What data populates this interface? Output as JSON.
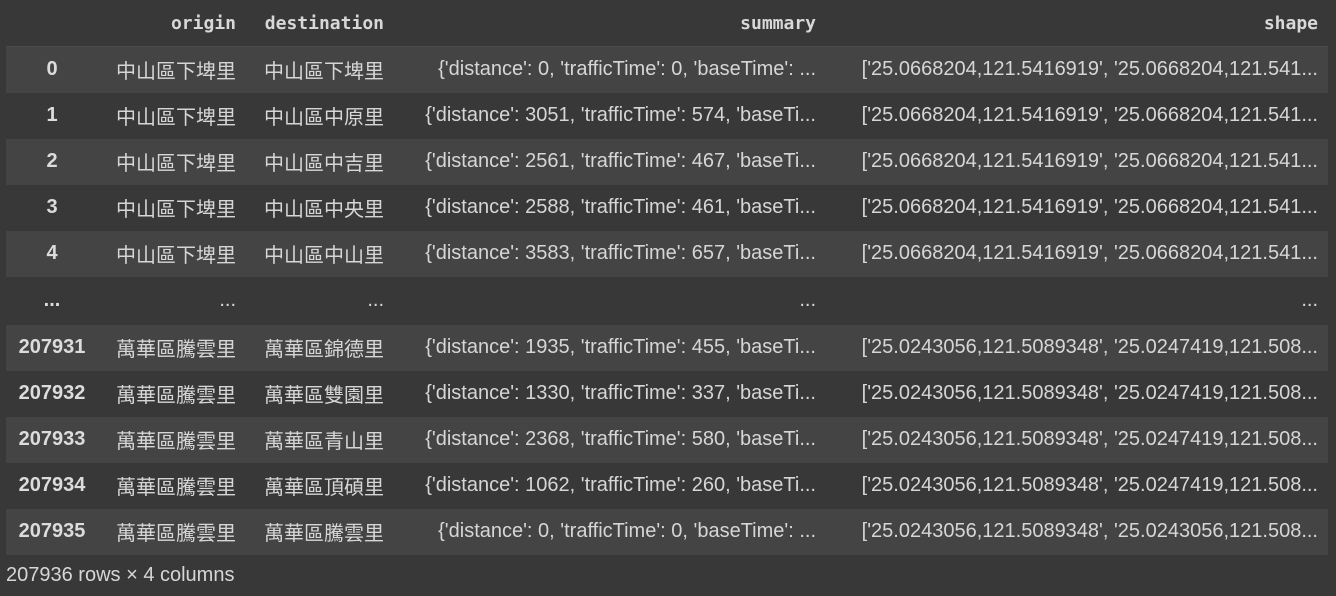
{
  "table": {
    "columns": {
      "index": "",
      "origin": "origin",
      "destination": "destination",
      "summary": "summary",
      "shape": "shape"
    },
    "rows": [
      {
        "index": "0",
        "origin": "中山區下埤里",
        "destination": "中山區下埤里",
        "summary": "{'distance': 0, 'trafficTime': 0, 'baseTime': ...",
        "shape": "['25.0668204,121.5416919', '25.0668204,121.541..."
      },
      {
        "index": "1",
        "origin": "中山區下埤里",
        "destination": "中山區中原里",
        "summary": "{'distance': 3051, 'trafficTime': 574, 'baseTi...",
        "shape": "['25.0668204,121.5416919', '25.0668204,121.541..."
      },
      {
        "index": "2",
        "origin": "中山區下埤里",
        "destination": "中山區中吉里",
        "summary": "{'distance': 2561, 'trafficTime': 467, 'baseTi...",
        "shape": "['25.0668204,121.5416919', '25.0668204,121.541..."
      },
      {
        "index": "3",
        "origin": "中山區下埤里",
        "destination": "中山區中央里",
        "summary": "{'distance': 2588, 'trafficTime': 461, 'baseTi...",
        "shape": "['25.0668204,121.5416919', '25.0668204,121.541..."
      },
      {
        "index": "4",
        "origin": "中山區下埤里",
        "destination": "中山區中山里",
        "summary": "{'distance': 3583, 'trafficTime': 657, 'baseTi...",
        "shape": "['25.0668204,121.5416919', '25.0668204,121.541..."
      },
      {
        "index": "...",
        "origin": "...",
        "destination": "...",
        "summary": "...",
        "shape": "..."
      },
      {
        "index": "207931",
        "origin": "萬華區騰雲里",
        "destination": "萬華區錦德里",
        "summary": "{'distance': 1935, 'trafficTime': 455, 'baseTi...",
        "shape": "['25.0243056,121.5089348', '25.0247419,121.508..."
      },
      {
        "index": "207932",
        "origin": "萬華區騰雲里",
        "destination": "萬華區雙園里",
        "summary": "{'distance': 1330, 'trafficTime': 337, 'baseTi...",
        "shape": "['25.0243056,121.5089348', '25.0247419,121.508..."
      },
      {
        "index": "207933",
        "origin": "萬華區騰雲里",
        "destination": "萬華區青山里",
        "summary": "{'distance': 2368, 'trafficTime': 580, 'baseTi...",
        "shape": "['25.0243056,121.5089348', '25.0247419,121.508..."
      },
      {
        "index": "207934",
        "origin": "萬華區騰雲里",
        "destination": "萬華區頂碩里",
        "summary": "{'distance': 1062, 'trafficTime': 260, 'baseTi...",
        "shape": "['25.0243056,121.5089348', '25.0247419,121.508..."
      },
      {
        "index": "207935",
        "origin": "萬華區騰雲里",
        "destination": "萬華區騰雲里",
        "summary": "{'distance': 0, 'trafficTime': 0, 'baseTime': ...",
        "shape": "['25.0243056,121.5089348', '25.0243056,121.508..."
      }
    ]
  },
  "footer": {
    "shape_text": "207936 rows × 4 columns"
  },
  "colors": {
    "background": "#383838",
    "row_stripe": "#444444",
    "text": "#d6d6d6"
  }
}
